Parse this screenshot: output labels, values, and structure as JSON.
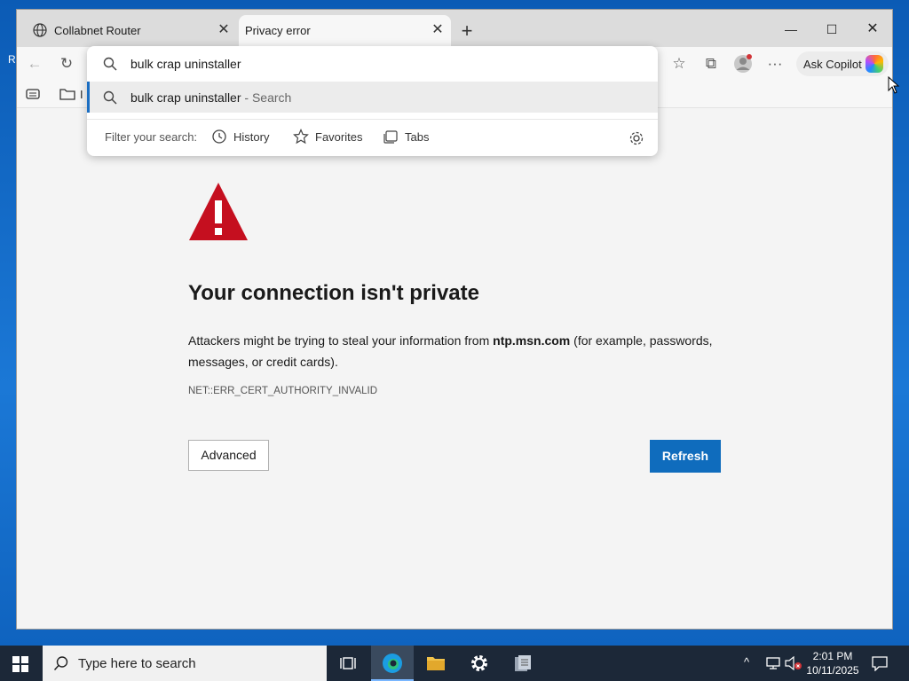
{
  "desktop": {
    "label_left": "R"
  },
  "tabs": [
    {
      "title": "Collabnet Router"
    },
    {
      "title": "Privacy error"
    }
  ],
  "toolbar": {
    "copilot_label": "Ask Copilot",
    "fav_item_text": "I"
  },
  "omnibox": {
    "query": "bulk crap uninstaller",
    "suggestion": "bulk crap uninstaller",
    "suggestion_suffix": " - Search",
    "filter_label": "Filter your search:",
    "filters": [
      "History",
      "Favorites",
      "Tabs"
    ]
  },
  "error_page": {
    "heading": "Your connection isn't private",
    "body_before": "Attackers might be trying to steal your information from ",
    "host": "ntp.msn.com",
    "body_after": " (for example, passwords, messages, or credit cards).",
    "error_code": "NET::ERR_CERT_AUTHORITY_INVALID",
    "advanced_label": "Advanced",
    "refresh_label": "Refresh"
  },
  "taskbar": {
    "search_placeholder": "Type here to search",
    "time": "2:01 PM",
    "date": "10/11/2025"
  },
  "colors": {
    "accent": "#0f6cbd",
    "warning_red": "#c50f1f"
  }
}
